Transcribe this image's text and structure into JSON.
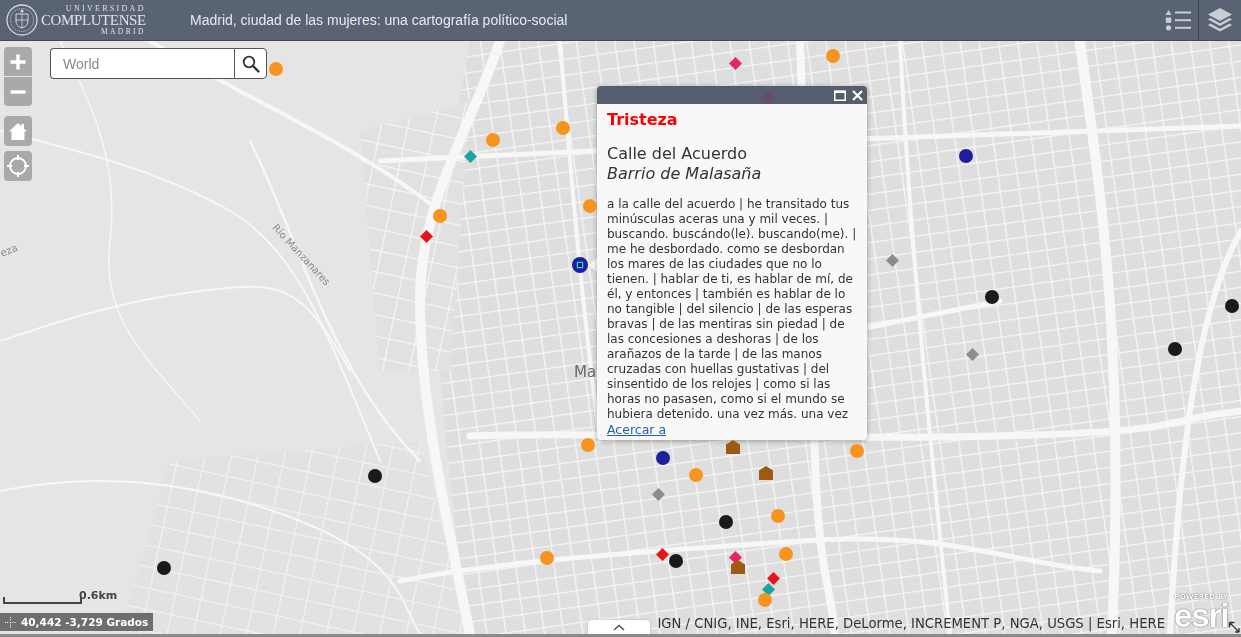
{
  "header": {
    "logo": {
      "top": "UNIVERSIDAD",
      "name": "COMPLUTENSE",
      "bottom": "MADRID"
    },
    "title": "Madrid, ciudad de las mujeres: una cartografía político-social"
  },
  "map": {
    "search": {
      "placeholder": "World"
    },
    "labels": [
      {
        "text": "Río Manzanares"
      },
      {
        "text": "eza"
      },
      {
        "text": "Ma"
      }
    ],
    "markers": [
      {
        "kind": "circle",
        "color": "#f7941d",
        "selected": false
      },
      {
        "kind": "diamond",
        "color": "#e6256f",
        "selected": false
      },
      {
        "kind": "circle",
        "color": "#f7941d",
        "selected": false
      },
      {
        "kind": "diamond",
        "color": "#6b4a6b",
        "selected": false
      },
      {
        "kind": "circle",
        "color": "#f7941d",
        "selected": false
      },
      {
        "kind": "circle",
        "color": "#f7941d",
        "selected": false
      },
      {
        "kind": "diamond",
        "color": "#1aa3a3",
        "selected": false
      },
      {
        "kind": "circle",
        "color": "#1f1f9e",
        "selected": false
      },
      {
        "kind": "circle",
        "color": "#f7941d",
        "selected": false
      },
      {
        "kind": "circle",
        "color": "#f7941d",
        "selected": false
      },
      {
        "kind": "diamond",
        "color": "#e8141c",
        "selected": false
      },
      {
        "kind": "circle",
        "color": "#1f1f9e",
        "selected": true
      },
      {
        "kind": "diamond",
        "color": "#8c8c8c",
        "selected": false
      },
      {
        "kind": "circle",
        "color": "#1a1a1a",
        "selected": false
      },
      {
        "kind": "circle",
        "color": "#1a1a1a",
        "selected": false
      },
      {
        "kind": "circle",
        "color": "#1a1a1a",
        "selected": false
      },
      {
        "kind": "diamond",
        "color": "#8c8c8c",
        "selected": false
      },
      {
        "kind": "circle",
        "color": "#f7941d",
        "selected": false
      },
      {
        "kind": "circle",
        "color": "#1f1f9e",
        "selected": false
      },
      {
        "kind": "house",
        "color": "#9c5a14",
        "selected": false
      },
      {
        "kind": "circle",
        "color": "#f7941d",
        "selected": false
      },
      {
        "kind": "circle",
        "color": "#f7941d",
        "selected": false
      },
      {
        "kind": "house",
        "color": "#9c5a14",
        "selected": false
      },
      {
        "kind": "diamond",
        "color": "#8c8c8c",
        "selected": false
      },
      {
        "kind": "circle",
        "color": "#1a1a1a",
        "selected": false
      },
      {
        "kind": "circle",
        "color": "#1a1a1a",
        "selected": false
      },
      {
        "kind": "circle",
        "color": "#f7941d",
        "selected": false
      },
      {
        "kind": "circle",
        "color": "#f7941d",
        "selected": false
      },
      {
        "kind": "diamond",
        "color": "#e8141c",
        "selected": false
      },
      {
        "kind": "circle",
        "color": "#1a1a1a",
        "selected": false
      },
      {
        "kind": "diamond",
        "color": "#e6256f",
        "selected": false
      },
      {
        "kind": "house",
        "color": "#9c5a14",
        "selected": false
      },
      {
        "kind": "circle",
        "color": "#f7941d",
        "selected": false
      },
      {
        "kind": "diamond",
        "color": "#e8141c",
        "selected": false
      },
      {
        "kind": "diamond",
        "color": "#1aa3a3",
        "selected": false
      },
      {
        "kind": "circle",
        "color": "#f7941d",
        "selected": false
      },
      {
        "kind": "circle",
        "color": "#1a1a1a",
        "selected": false
      }
    ],
    "scale": "0.6km",
    "coordinates": "40,442 -3,729 Grados",
    "attribution": "IGN / CNIG, INE, Esri, HERE, DeLorme, INCREMENT P, NGA, USGS | Esri, HERE",
    "esri": {
      "caption": "POWERED BY",
      "wordmark": "esri"
    }
  },
  "popup": {
    "category": "Tristeza",
    "title": "Calle del Acuerdo",
    "subtitle": "Barrio de Malasaña",
    "text": "a la calle del acuerdo | he transitado tus minúsculas aceras una y mil veces. | buscando. buscándo(le). buscando(me). | me he desbordado. como se desbordan los mares de las ciudades que no lo tienen. | hablar de ti, es hablar de mí, de él, y entonces | también es hablar de lo no tangible | del silencio | de las esperas bravas | de las mentiras sin piedad | de las concesiones a deshoras | de los arañazos de la tarde | de las manos cruzadas con huellas gustativas | del sinsentido de los relojes | como si las horas no pasasen, como si el mundo se hubiera detenido. una vez más. una vez",
    "link": "Acercar a"
  }
}
